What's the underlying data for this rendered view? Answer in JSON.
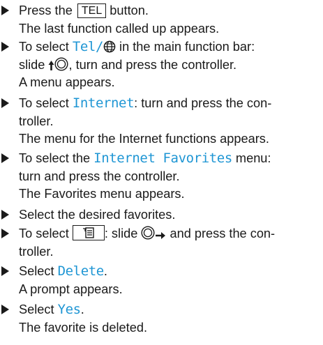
{
  "steps": [
    {
      "parts": {
        "a": "Press the ",
        "key": "TEL",
        "b": " button."
      },
      "result": "The last function called up appears."
    },
    {
      "parts": {
        "a": "To select ",
        "item": "Tel/",
        "b": " in the main function bar:",
        "c": "slide ",
        "d": ", turn and press the controller."
      },
      "result": "A menu appears."
    },
    {
      "parts": {
        "a": "To select ",
        "item": "Internet",
        "b": ": turn and press the con-",
        "c": "troller."
      },
      "result": "The menu for the Internet functions appears."
    },
    {
      "parts": {
        "a": "To select the ",
        "item": "Internet Favorites",
        "b": " menu:",
        "c": "turn and press the controller."
      },
      "result": "The Favorites menu appears."
    },
    {
      "parts": {
        "a": "Select the desired favorites."
      }
    },
    {
      "parts": {
        "a": "To select ",
        "b": ": slide ",
        "c": " and press the con-",
        "d": "troller."
      }
    },
    {
      "parts": {
        "a": "Select ",
        "item": "Delete",
        "b": "."
      },
      "result": "A prompt appears."
    },
    {
      "parts": {
        "a": "Select ",
        "item": "Yes",
        "b": "."
      },
      "result": "The favorite is deleted."
    }
  ],
  "icons": {
    "globe": "globe-icon",
    "up_arrow": "up-arrow-icon",
    "right_arrow": "right-arrow-icon",
    "controller": "controller-icon",
    "menu_list": "menu-list-icon"
  },
  "colors": {
    "highlight": "#1f96d4",
    "text": "#1a1a1a"
  }
}
